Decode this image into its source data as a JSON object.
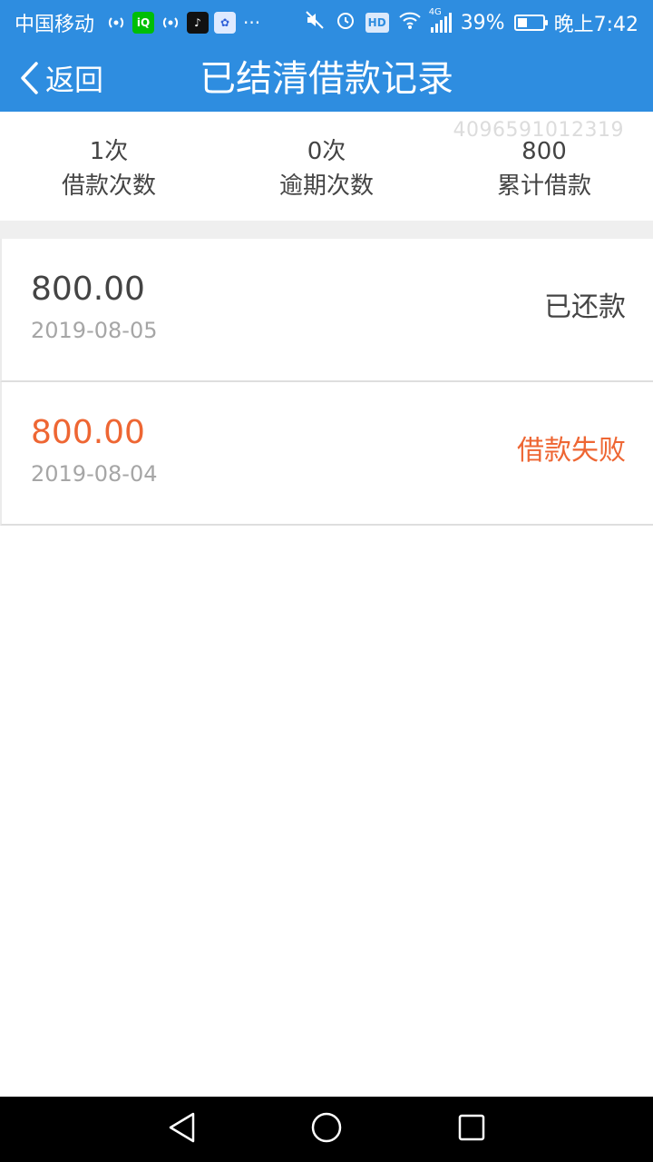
{
  "status_bar": {
    "carrier": "中国移动",
    "more": "···",
    "hd": "HD",
    "network_type": "4G",
    "battery_percent_text": "39%",
    "battery_level": 0.39,
    "time": "晚上7:42",
    "app_icons": [
      "hotspot-icon",
      "iqiyi-icon",
      "hotspot-icon",
      "tiktok-icon",
      "baidu-icon"
    ]
  },
  "header": {
    "back_label": "返回",
    "title": "已结清借款记录"
  },
  "summary": {
    "watermark": "4096591012319",
    "stats": [
      {
        "value": "1次",
        "label": "借款次数"
      },
      {
        "value": "0次",
        "label": "逾期次数"
      },
      {
        "value": "800",
        "label": "累计借款"
      }
    ]
  },
  "records": [
    {
      "amount": "800.00",
      "date": "2019-08-05",
      "status": "已还款",
      "status_color": "#444444"
    },
    {
      "amount": "800.00",
      "date": "2019-08-04",
      "status": "借款失败",
      "status_color": "#ee6633"
    }
  ],
  "colors": {
    "primary": "#2e8de0",
    "failed": "#ee6633",
    "text": "#444444",
    "muted": "#a6a6a6"
  }
}
